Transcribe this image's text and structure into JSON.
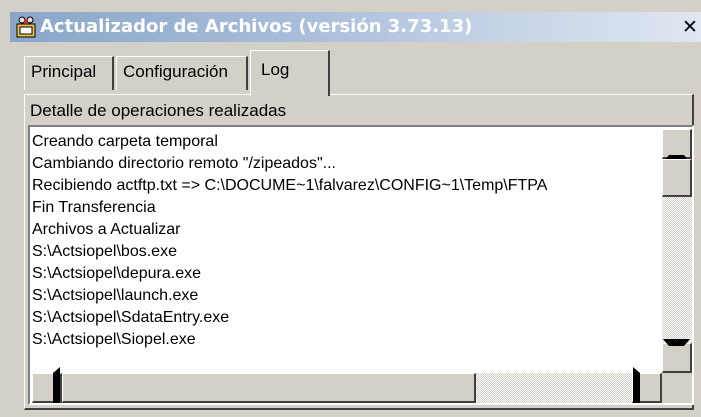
{
  "window": {
    "title": "Actualizador de Archivos (versión 3.73.13)",
    "close_glyph": "✕",
    "title_icon": "app-update-icon"
  },
  "tabs": [
    {
      "label": "Principal",
      "active": false
    },
    {
      "label": "Configuración",
      "active": false
    },
    {
      "label": "Log",
      "active": true
    }
  ],
  "log": {
    "group_label": "Detalle de operaciones realizadas",
    "lines": [
      "Creando carpeta temporal",
      "Cambiando directorio remoto \"/zipeados\"...",
      "Recibiendo actftp.txt => C:\\DOCUME~1\\falvarez\\CONFIG~1\\Temp\\FTPA",
      "Fin Transferencia",
      "Archivos a Actualizar",
      "S:\\Actsiopel\\bos.exe",
      "S:\\Actsiopel\\depura.exe",
      "S:\\Actsiopel\\launch.exe",
      "S:\\Actsiopel\\SdataEntry.exe",
      "S:\\Actsiopel\\Siopel.exe"
    ]
  },
  "colors": {
    "face": "#d4d0c8",
    "title_gradient_start": "#8aa6c9",
    "title_gradient_end": "#dfe6f0"
  }
}
